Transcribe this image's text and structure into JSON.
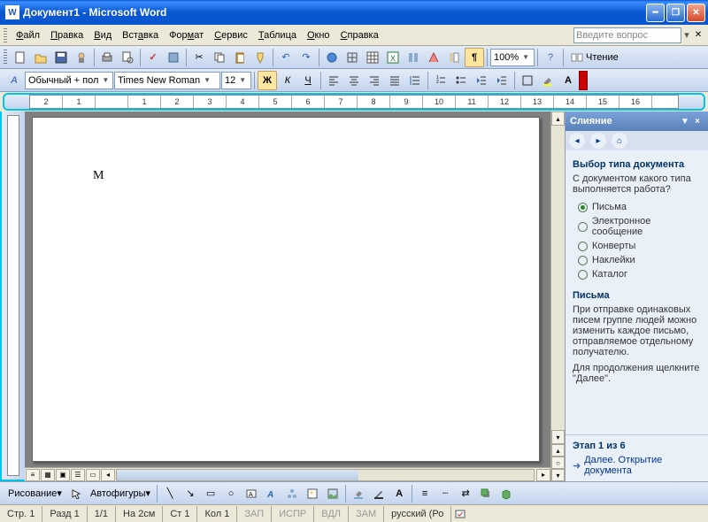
{
  "title": "Документ1 - Microsoft Word",
  "help_placeholder": "Введите вопрос",
  "menu": [
    "Файл",
    "Правка",
    "Вид",
    "Вставка",
    "Формат",
    "Сервис",
    "Таблица",
    "Окно",
    "Справка"
  ],
  "toolbar": {
    "zoom": "100%",
    "read_label": "Чтение"
  },
  "format": {
    "style": "Обычный + пол",
    "font": "Times New Roman",
    "size": "12",
    "bold": "Ж",
    "italic": "К",
    "underline": "Ч"
  },
  "ruler_nums": [
    "2",
    "1",
    "",
    "1",
    "2",
    "3",
    "4",
    "5",
    "6",
    "7",
    "8",
    "9",
    "10",
    "11",
    "12",
    "13",
    "14",
    "15",
    "16"
  ],
  "doc_text": "М",
  "taskpane": {
    "title": "Слияние",
    "section1_title": "Выбор типа документа",
    "section1_desc": "С документом какого типа выполняется работа?",
    "options": [
      {
        "label": "Письма",
        "selected": true
      },
      {
        "label": "Электронное сообщение",
        "selected": false
      },
      {
        "label": "Конверты",
        "selected": false
      },
      {
        "label": "Наклейки",
        "selected": false
      },
      {
        "label": "Каталог",
        "selected": false
      }
    ],
    "section2_title": "Письма",
    "section2_desc": "При отправке одинаковых писем группе людей можно изменить каждое письмо, отправляемое отдельному получателю.",
    "section2_cont": "Для продолжения щелкните \"Далее\".",
    "step": "Этап 1 из 6",
    "next_link": "Далее. Открытие документа"
  },
  "draw": {
    "label": "Рисование",
    "autoshapes": "Автофигуры"
  },
  "status": {
    "page": "Стр. 1",
    "section": "Разд 1",
    "pages": "1/1",
    "at": "На 2см",
    "line": "Ст 1",
    "col": "Кол 1",
    "rec": "ЗАП",
    "trk": "ИСПР",
    "ext": "ВДЛ",
    "ovr": "ЗАМ",
    "lang": "русский (Ро"
  }
}
